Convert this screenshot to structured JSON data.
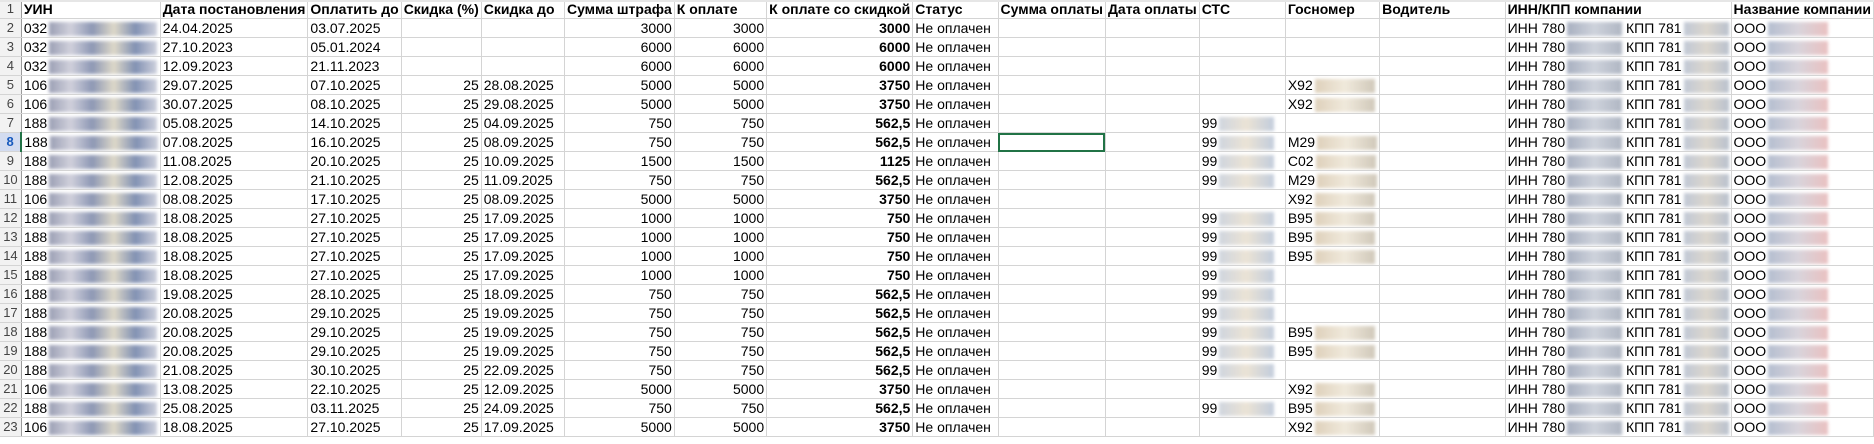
{
  "headers": [
    "УИН",
    "Дата постановления",
    "Оплатить до",
    "Скидка (%)",
    "Скидка до",
    "Сумма штрафа",
    "К оплате",
    "К оплате со скидкой",
    "Статус",
    "Сумма оплаты",
    "Дата оплаты",
    "СТС",
    "Госномер",
    "Водитель",
    "ИНН/КПП компании",
    "Название компании"
  ],
  "row_numbers": [
    "1",
    "2",
    "3",
    "4",
    "5",
    "6",
    "7",
    "8",
    "9",
    "10",
    "11",
    "12",
    "13",
    "14",
    "15",
    "16",
    "17",
    "18",
    "19",
    "20",
    "21",
    "22",
    "23"
  ],
  "selected_row": "8",
  "inn_prefix": "ИНН 780",
  "kpp_prefix": "КПП 781",
  "company_prefix": "ООО",
  "rows": [
    {
      "uin": "032",
      "date": "24.04.2025",
      "pay_by": "03.07.2025",
      "disc": "",
      "disc_until": "",
      "fine": "3000",
      "to_pay": "3000",
      "to_pay_disc": "3000",
      "status": "Не оплачен",
      "sts": "",
      "plate": ""
    },
    {
      "uin": "032",
      "date": "27.10.2023",
      "pay_by": "05.01.2024",
      "disc": "",
      "disc_until": "",
      "fine": "6000",
      "to_pay": "6000",
      "to_pay_disc": "6000",
      "status": "Не оплачен",
      "sts": "",
      "plate": ""
    },
    {
      "uin": "032",
      "date": "12.09.2023",
      "pay_by": "21.11.2023",
      "disc": "",
      "disc_until": "",
      "fine": "6000",
      "to_pay": "6000",
      "to_pay_disc": "6000",
      "status": "Не оплачен",
      "sts": "",
      "plate": ""
    },
    {
      "uin": "106",
      "date": "29.07.2025",
      "pay_by": "07.10.2025",
      "disc": "25",
      "disc_until": "28.08.2025",
      "fine": "5000",
      "to_pay": "5000",
      "to_pay_disc": "3750",
      "status": "Не оплачен",
      "sts": "",
      "plate": "X92"
    },
    {
      "uin": "106",
      "date": "30.07.2025",
      "pay_by": "08.10.2025",
      "disc": "25",
      "disc_until": "29.08.2025",
      "fine": "5000",
      "to_pay": "5000",
      "to_pay_disc": "3750",
      "status": "Не оплачен",
      "sts": "",
      "plate": "X92"
    },
    {
      "uin": "188",
      "date": "05.08.2025",
      "pay_by": "14.10.2025",
      "disc": "25",
      "disc_until": "04.09.2025",
      "fine": "750",
      "to_pay": "750",
      "to_pay_disc": "562,5",
      "status": "Не оплачен",
      "sts": "99",
      "plate": ""
    },
    {
      "uin": "188",
      "date": "07.08.2025",
      "pay_by": "16.10.2025",
      "disc": "25",
      "disc_until": "08.09.2025",
      "fine": "750",
      "to_pay": "750",
      "to_pay_disc": "562,5",
      "status": "Не оплачен",
      "sts": "99",
      "plate": "M29"
    },
    {
      "uin": "188",
      "date": "11.08.2025",
      "pay_by": "20.10.2025",
      "disc": "25",
      "disc_until": "10.09.2025",
      "fine": "1500",
      "to_pay": "1500",
      "to_pay_disc": "1125",
      "status": "Не оплачен",
      "sts": "99",
      "plate": "C02"
    },
    {
      "uin": "188",
      "date": "12.08.2025",
      "pay_by": "21.10.2025",
      "disc": "25",
      "disc_until": "11.09.2025",
      "fine": "750",
      "to_pay": "750",
      "to_pay_disc": "562,5",
      "status": "Не оплачен",
      "sts": "99",
      "plate": "M29"
    },
    {
      "uin": "106",
      "date": "08.08.2025",
      "pay_by": "17.10.2025",
      "disc": "25",
      "disc_until": "08.09.2025",
      "fine": "5000",
      "to_pay": "5000",
      "to_pay_disc": "3750",
      "status": "Не оплачен",
      "sts": "",
      "plate": "X92"
    },
    {
      "uin": "188",
      "date": "18.08.2025",
      "pay_by": "27.10.2025",
      "disc": "25",
      "disc_until": "17.09.2025",
      "fine": "1000",
      "to_pay": "1000",
      "to_pay_disc": "750",
      "status": "Не оплачен",
      "sts": "99",
      "plate": "B95"
    },
    {
      "uin": "188",
      "date": "18.08.2025",
      "pay_by": "27.10.2025",
      "disc": "25",
      "disc_until": "17.09.2025",
      "fine": "1000",
      "to_pay": "1000",
      "to_pay_disc": "750",
      "status": "Не оплачен",
      "sts": "99",
      "plate": "B95"
    },
    {
      "uin": "188",
      "date": "18.08.2025",
      "pay_by": "27.10.2025",
      "disc": "25",
      "disc_until": "17.09.2025",
      "fine": "1000",
      "to_pay": "1000",
      "to_pay_disc": "750",
      "status": "Не оплачен",
      "sts": "99",
      "plate": "B95"
    },
    {
      "uin": "188",
      "date": "18.08.2025",
      "pay_by": "27.10.2025",
      "disc": "25",
      "disc_until": "17.09.2025",
      "fine": "1000",
      "to_pay": "1000",
      "to_pay_disc": "750",
      "status": "Не оплачен",
      "sts": "99",
      "plate": ""
    },
    {
      "uin": "188",
      "date": "19.08.2025",
      "pay_by": "28.10.2025",
      "disc": "25",
      "disc_until": "18.09.2025",
      "fine": "750",
      "to_pay": "750",
      "to_pay_disc": "562,5",
      "status": "Не оплачен",
      "sts": "99",
      "plate": ""
    },
    {
      "uin": "188",
      "date": "20.08.2025",
      "pay_by": "29.10.2025",
      "disc": "25",
      "disc_until": "19.09.2025",
      "fine": "750",
      "to_pay": "750",
      "to_pay_disc": "562,5",
      "status": "Не оплачен",
      "sts": "99",
      "plate": ""
    },
    {
      "uin": "188",
      "date": "20.08.2025",
      "pay_by": "29.10.2025",
      "disc": "25",
      "disc_until": "19.09.2025",
      "fine": "750",
      "to_pay": "750",
      "to_pay_disc": "562,5",
      "status": "Не оплачен",
      "sts": "99",
      "plate": "B95"
    },
    {
      "uin": "188",
      "date": "20.08.2025",
      "pay_by": "29.10.2025",
      "disc": "25",
      "disc_until": "19.09.2025",
      "fine": "750",
      "to_pay": "750",
      "to_pay_disc": "562,5",
      "status": "Не оплачен",
      "sts": "99",
      "plate": "B95"
    },
    {
      "uin": "188",
      "date": "21.08.2025",
      "pay_by": "30.10.2025",
      "disc": "25",
      "disc_until": "22.09.2025",
      "fine": "750",
      "to_pay": "750",
      "to_pay_disc": "562,5",
      "status": "Не оплачен",
      "sts": "99",
      "plate": ""
    },
    {
      "uin": "106",
      "date": "13.08.2025",
      "pay_by": "22.10.2025",
      "disc": "25",
      "disc_until": "12.09.2025",
      "fine": "5000",
      "to_pay": "5000",
      "to_pay_disc": "3750",
      "status": "Не оплачен",
      "sts": "",
      "plate": "X92"
    },
    {
      "uin": "188",
      "date": "25.08.2025",
      "pay_by": "03.11.2025",
      "disc": "25",
      "disc_until": "24.09.2025",
      "fine": "750",
      "to_pay": "750",
      "to_pay_disc": "562,5",
      "status": "Не оплачен",
      "sts": "99",
      "plate": "B95"
    },
    {
      "uin": "106",
      "date": "18.08.2025",
      "pay_by": "27.10.2025",
      "disc": "25",
      "disc_until": "17.09.2025",
      "fine": "5000",
      "to_pay": "5000",
      "to_pay_disc": "3750",
      "status": "Не оплачен",
      "sts": "",
      "plate": "X92"
    }
  ],
  "colors": {
    "grid": "#d4d4d4",
    "header_bg": "#f2f2f2",
    "selection": "#217346",
    "selected_header": "#d3dcf0"
  }
}
